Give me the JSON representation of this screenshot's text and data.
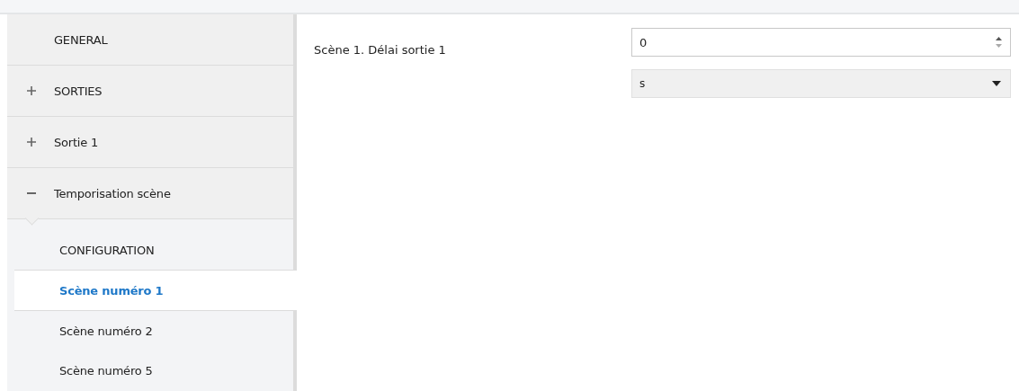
{
  "sidebar": {
    "items": [
      {
        "kind": "page",
        "label": "GENERAL",
        "selected": false
      },
      {
        "kind": "group",
        "label": "SORTIES",
        "expanded": false,
        "selected": false
      },
      {
        "kind": "group",
        "label": "Sortie 1",
        "expanded": false,
        "selected": false
      },
      {
        "kind": "group",
        "label": "Temporisation scène",
        "expanded": true,
        "selected": false,
        "children": [
          {
            "label": "CONFIGURATION",
            "selected": false
          },
          {
            "label": "Scène numéro 1",
            "selected": true
          },
          {
            "label": "Scène numéro 2",
            "selected": false
          },
          {
            "label": "Scène numéro 5",
            "selected": false
          }
        ]
      }
    ]
  },
  "parameters": [
    {
      "label": "Scène 1. Délai sortie 1",
      "value": "0",
      "unit": "s"
    }
  ]
}
